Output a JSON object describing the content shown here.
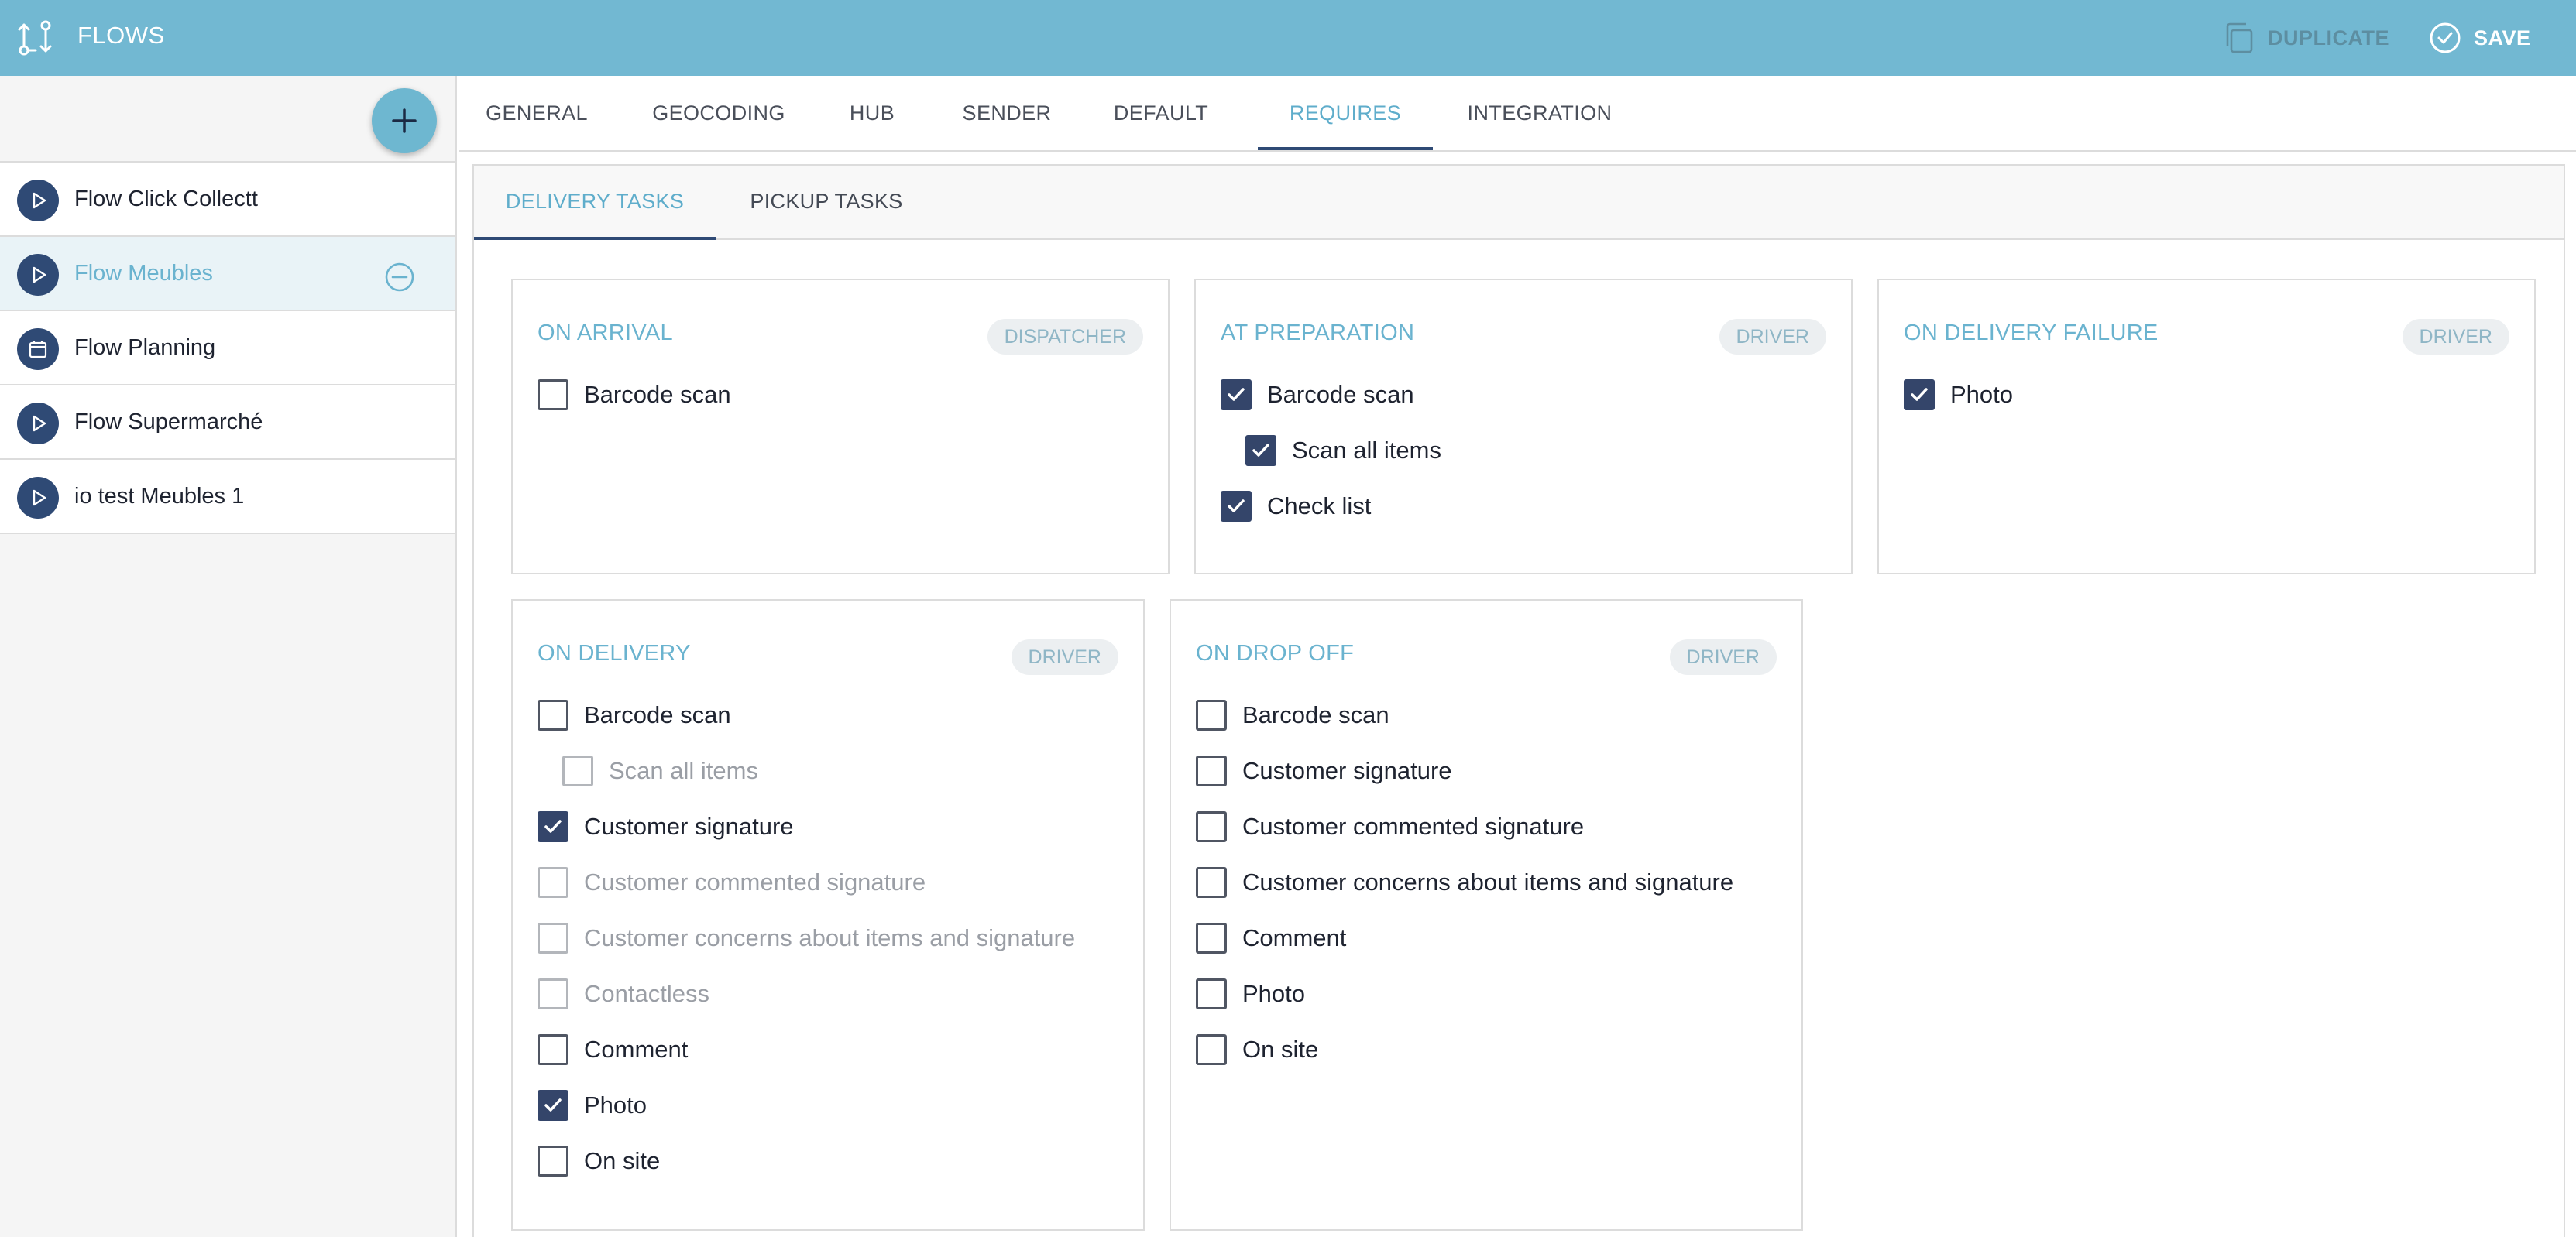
{
  "app": {
    "title": "FLOWS",
    "icon": "flow-branch-icon"
  },
  "header": {
    "duplicate_label": "DUPLICATE",
    "duplicate_icon": "copy-icon",
    "save_label": "SAVE",
    "save_icon": "check-circle-icon"
  },
  "colors": {
    "topbar": "#72b8d2",
    "accent": "#6ab3cf",
    "navy": "#2f4a75",
    "checked": "#34456a"
  },
  "sidebar": {
    "add_icon": "plus-icon",
    "items": [
      {
        "label": "Flow Click Collectt",
        "icon": "play-icon",
        "active": false
      },
      {
        "label": "Flow Meubles",
        "icon": "play-icon",
        "active": true,
        "action_icon": "remove-circle-icon"
      },
      {
        "label": "Flow Planning",
        "icon": "calendar-icon",
        "active": false
      },
      {
        "label": "Flow Supermarché",
        "icon": "play-icon",
        "active": false
      },
      {
        "label": "io test Meubles 1",
        "icon": "play-icon",
        "active": false
      }
    ]
  },
  "tabs": [
    {
      "label": "GENERAL"
    },
    {
      "label": "GEOCODING"
    },
    {
      "label": "HUB"
    },
    {
      "label": "SENDER"
    },
    {
      "label": "DEFAULT"
    },
    {
      "label": "REQUIRES",
      "active": true
    },
    {
      "label": "INTEGRATION"
    }
  ],
  "subtabs": [
    {
      "label": "DELIVERY TASKS",
      "active": true
    },
    {
      "label": "PICKUP TASKS"
    }
  ],
  "cards": [
    {
      "title": "ON ARRIVAL",
      "badge": "DISPATCHER",
      "options": [
        {
          "label": "Barcode scan",
          "checked": false
        }
      ]
    },
    {
      "title": "AT PREPARATION",
      "badge": "DRIVER",
      "options": [
        {
          "label": "Barcode scan",
          "checked": true
        },
        {
          "label": "Scan all items",
          "checked": true,
          "indent": true
        },
        {
          "label": "Check list",
          "checked": true
        }
      ]
    },
    {
      "title": "ON DELIVERY FAILURE",
      "badge": "DRIVER",
      "options": [
        {
          "label": "Photo",
          "checked": true
        }
      ]
    },
    {
      "title": "ON DELIVERY",
      "badge": "DRIVER",
      "options": [
        {
          "label": "Barcode scan",
          "checked": false
        },
        {
          "label": "Scan all items",
          "checked": false,
          "indent": true,
          "disabled": true
        },
        {
          "label": "Customer signature",
          "checked": true
        },
        {
          "label": "Customer commented signature",
          "checked": false,
          "disabled": true
        },
        {
          "label": "Customer concerns about items and signature",
          "checked": false,
          "disabled": true
        },
        {
          "label": "Contactless",
          "checked": false,
          "disabled": true
        },
        {
          "label": "Comment",
          "checked": false
        },
        {
          "label": "Photo",
          "checked": true
        },
        {
          "label": "On site",
          "checked": false
        }
      ]
    },
    {
      "title": "ON DROP OFF",
      "badge": "DRIVER",
      "options": [
        {
          "label": "Barcode scan",
          "checked": false
        },
        {
          "label": "Customer signature",
          "checked": false
        },
        {
          "label": "Customer commented signature",
          "checked": false
        },
        {
          "label": "Customer concerns about items and signature",
          "checked": false
        },
        {
          "label": "Comment",
          "checked": false
        },
        {
          "label": "Photo",
          "checked": false
        },
        {
          "label": "On site",
          "checked": false
        }
      ]
    }
  ]
}
